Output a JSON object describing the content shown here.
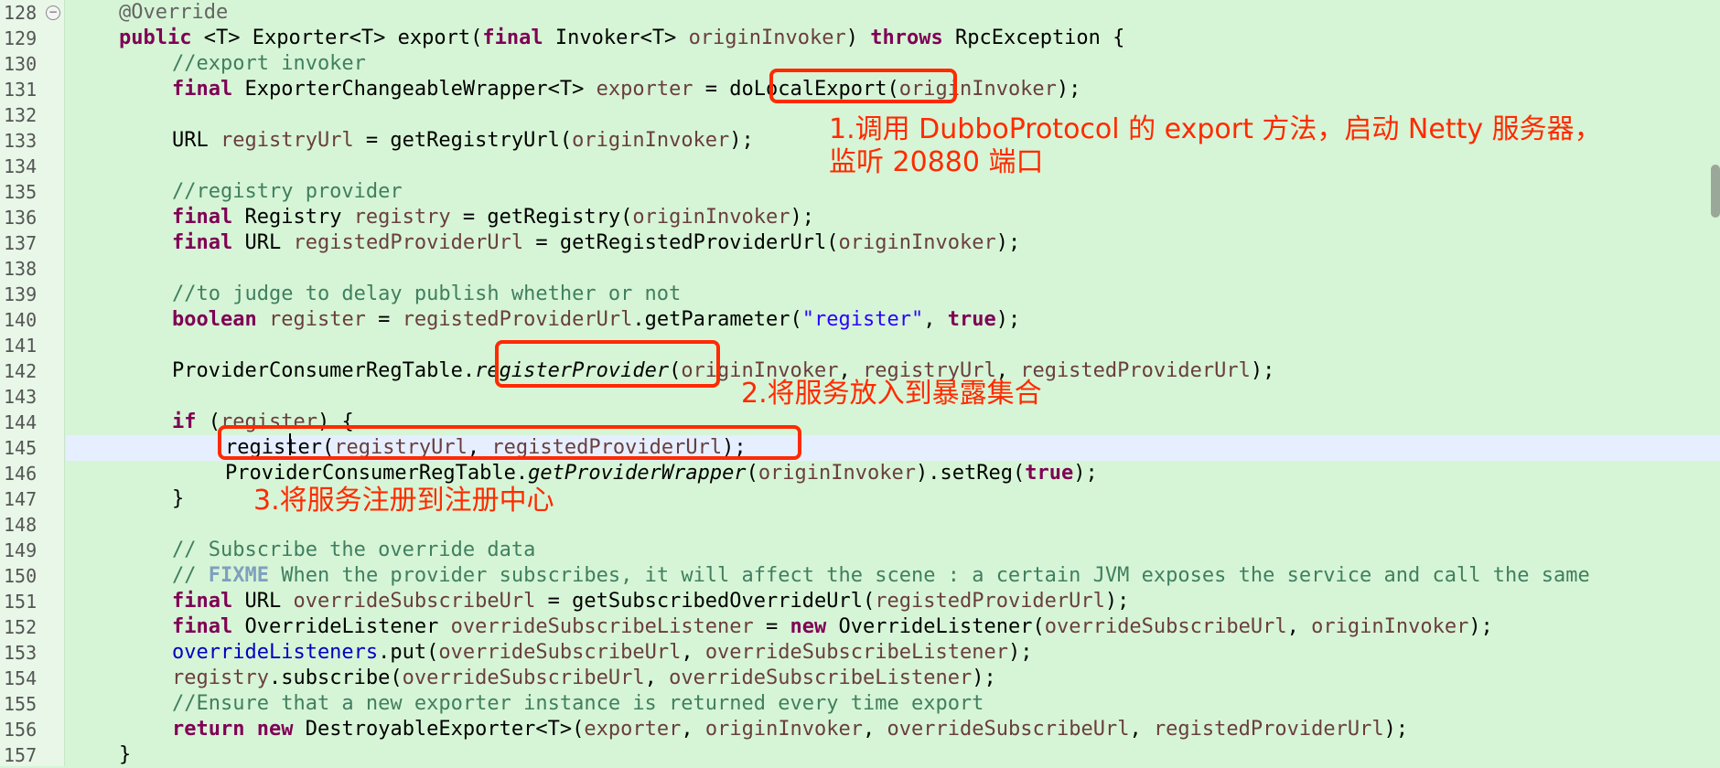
{
  "editor": {
    "lines": [
      {
        "num": "128",
        "code": "@Override"
      },
      {
        "num": "129",
        "code": "public <T> Exporter<T> export(final Invoker<T> originInvoker) throws RpcException {"
      },
      {
        "num": "130",
        "code": "//export invoker"
      },
      {
        "num": "131",
        "code": "final ExporterChangeableWrapper<T> exporter = doLocalExport(originInvoker);"
      },
      {
        "num": "132",
        "code": ""
      },
      {
        "num": "133",
        "code": "URL registryUrl = getRegistryUrl(originInvoker);"
      },
      {
        "num": "134",
        "code": ""
      },
      {
        "num": "135",
        "code": "//registry provider"
      },
      {
        "num": "136",
        "code": "final Registry registry = getRegistry(originInvoker);"
      },
      {
        "num": "137",
        "code": "final URL registedProviderUrl = getRegistedProviderUrl(originInvoker);"
      },
      {
        "num": "138",
        "code": ""
      },
      {
        "num": "139",
        "code": "//to judge to delay publish whether or not"
      },
      {
        "num": "140",
        "code": "boolean register = registedProviderUrl.getParameter(\"register\", true);"
      },
      {
        "num": "141",
        "code": ""
      },
      {
        "num": "142",
        "code": "ProviderConsumerRegTable.registerProvider(originInvoker, registryUrl, registedProviderUrl);"
      },
      {
        "num": "143",
        "code": ""
      },
      {
        "num": "144",
        "code": "if (register) {"
      },
      {
        "num": "145",
        "code": "register(registryUrl, registedProviderUrl);"
      },
      {
        "num": "146",
        "code": "ProviderConsumerRegTable.getProviderWrapper(originInvoker).setReg(true);"
      },
      {
        "num": "147",
        "code": "}"
      },
      {
        "num": "148",
        "code": ""
      },
      {
        "num": "149",
        "code": "// Subscribe the override data"
      },
      {
        "num": "150",
        "code": "// FIXME When the provider subscribes, it will affect the scene : a certain JVM exposes the service and call the same"
      },
      {
        "num": "151",
        "code": "final URL overrideSubscribeUrl = getSubscribedOverrideUrl(registedProviderUrl);"
      },
      {
        "num": "152",
        "code": "final OverrideListener overrideSubscribeListener = new OverrideListener(overrideSubscribeUrl, originInvoker);"
      },
      {
        "num": "153",
        "code": "overrideListeners.put(overrideSubscribeUrl, overrideSubscribeListener);"
      },
      {
        "num": "154",
        "code": "registry.subscribe(overrideSubscribeUrl, overrideSubscribeListener);"
      },
      {
        "num": "155",
        "code": "//Ensure that a new exporter instance is returned every time export"
      },
      {
        "num": "156",
        "code": "return new DestroyableExporter<T>(exporter, originInvoker, overrideSubscribeUrl, registedProviderUrl);"
      },
      {
        "num": "157",
        "code": "}"
      }
    ]
  },
  "annotations": {
    "note1": "1.调用 DubboProtocol 的 export 方法，启动 Netty 服务器，\n监听 20880 端口",
    "note2": "2.将服务放入到暴露集合",
    "note3": "3.将服务注册到注册中心"
  },
  "colors": {
    "background": "#d6f5d6",
    "annotation": "#ff2a00",
    "keyword": "#7f0055",
    "comment": "#3f7f5f",
    "string": "#2a00ff"
  }
}
